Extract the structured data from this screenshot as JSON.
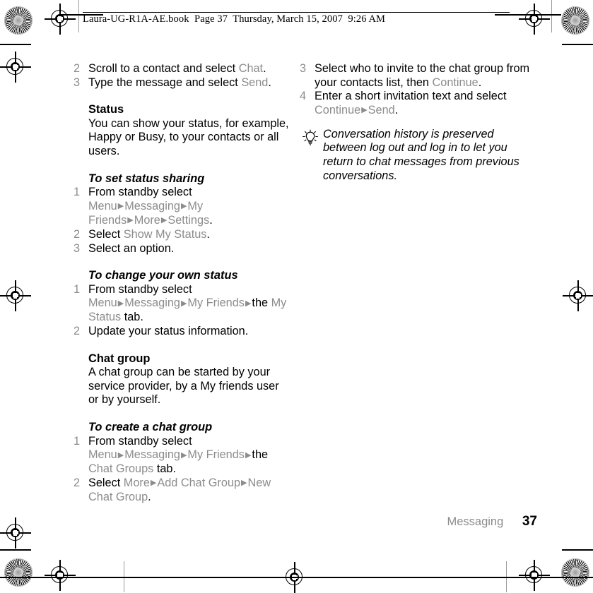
{
  "document": {
    "book_header": "Laura-UG-R1A-AE.book  Page 37  Thursday, March 15, 2007  9:26 AM",
    "footer_section": "Messaging",
    "page_number": "37",
    "colors": {
      "body_text": "#000000",
      "ui_term": "#8c8c8c",
      "background": "#ffffff"
    }
  },
  "left_column": {
    "steps_top": [
      {
        "num": "2",
        "parts": [
          {
            "t": "Scroll to a contact and select ",
            "s": "blk"
          },
          {
            "t": "Chat",
            "s": "ui"
          },
          {
            "t": ".",
            "s": "blk"
          }
        ]
      },
      {
        "num": "3",
        "parts": [
          {
            "t": "Type the message and select ",
            "s": "blk"
          },
          {
            "t": "Send",
            "s": "ui"
          },
          {
            "t": ".",
            "s": "blk"
          }
        ]
      }
    ],
    "status_heading": "Status",
    "status_body": "You can show your status, for example, Happy or Busy, to your contacts or all users.",
    "set_status_heading": "To set status sharing",
    "set_status_steps": [
      {
        "num": "1",
        "parts": [
          {
            "t": "From standby select ",
            "s": "blk"
          },
          {
            "t": "Menu",
            "s": "ui"
          },
          {
            "t": "▶",
            "s": "arrow"
          },
          {
            "t": "Messaging",
            "s": "ui"
          },
          {
            "t": "▶",
            "s": "arrow"
          },
          {
            "t": "My Friends",
            "s": "ui"
          },
          {
            "t": "▶",
            "s": "arrow"
          },
          {
            "t": "More",
            "s": "ui"
          },
          {
            "t": "▶",
            "s": "arrow"
          },
          {
            "t": "Settings",
            "s": "ui"
          },
          {
            "t": ".",
            "s": "blk"
          }
        ]
      },
      {
        "num": "2",
        "parts": [
          {
            "t": "Select ",
            "s": "blk"
          },
          {
            "t": "Show My Status",
            "s": "ui"
          },
          {
            "t": ".",
            "s": "blk"
          }
        ]
      },
      {
        "num": "3",
        "parts": [
          {
            "t": "Select an option.",
            "s": "blk"
          }
        ]
      }
    ],
    "change_status_heading": "To change your own status",
    "change_status_steps": [
      {
        "num": "1",
        "parts": [
          {
            "t": "From standby select ",
            "s": "blk"
          },
          {
            "t": "Menu",
            "s": "ui"
          },
          {
            "t": "▶",
            "s": "arrow"
          },
          {
            "t": "Messaging",
            "s": "ui"
          },
          {
            "t": "▶",
            "s": "arrow"
          },
          {
            "t": "My Friends",
            "s": "ui"
          },
          {
            "t": "▶",
            "s": "arrow"
          },
          {
            "t": "the ",
            "s": "blk"
          },
          {
            "t": "My Status",
            "s": "ui"
          },
          {
            "t": " tab.",
            "s": "blk"
          }
        ]
      },
      {
        "num": "2",
        "parts": [
          {
            "t": "Update your status information.",
            "s": "blk"
          }
        ]
      }
    ],
    "chat_group_heading": "Chat group",
    "chat_group_body": "A chat group can be started by your service provider, by a My friends user or by yourself.",
    "create_group_heading": "To create a chat group",
    "create_group_steps": [
      {
        "num": "1",
        "parts": [
          {
            "t": "From standby select ",
            "s": "blk"
          },
          {
            "t": "Menu",
            "s": "ui"
          },
          {
            "t": "▶",
            "s": "arrow"
          },
          {
            "t": "Messaging",
            "s": "ui"
          },
          {
            "t": "▶",
            "s": "arrow"
          },
          {
            "t": "My Friends",
            "s": "ui"
          },
          {
            "t": "▶",
            "s": "arrow"
          },
          {
            "t": "the ",
            "s": "blk"
          },
          {
            "t": "Chat Groups",
            "s": "ui"
          },
          {
            "t": " tab.",
            "s": "blk"
          }
        ]
      },
      {
        "num": "2",
        "parts": [
          {
            "t": "Select ",
            "s": "blk"
          },
          {
            "t": "More",
            "s": "ui"
          },
          {
            "t": "▶",
            "s": "arrow"
          },
          {
            "t": "Add Chat Group",
            "s": "ui"
          },
          {
            "t": "▶",
            "s": "arrow"
          },
          {
            "t": "New Chat Group",
            "s": "ui"
          },
          {
            "t": ".",
            "s": "blk"
          }
        ]
      }
    ]
  },
  "right_column": {
    "steps": [
      {
        "num": "3",
        "parts": [
          {
            "t": "Select who to invite to the chat group from your contacts list, then ",
            "s": "blk"
          },
          {
            "t": "Continue",
            "s": "ui"
          },
          {
            "t": ".",
            "s": "blk"
          }
        ]
      },
      {
        "num": "4",
        "parts": [
          {
            "t": "Enter a short invitation text and select ",
            "s": "blk"
          },
          {
            "t": "Continue",
            "s": "ui"
          },
          {
            "t": "▶",
            "s": "arrow"
          },
          {
            "t": "Send",
            "s": "ui"
          },
          {
            "t": ".",
            "s": "blk"
          }
        ]
      }
    ],
    "tip": {
      "icon": "lightbulb-tip-icon",
      "text": "Conversation history is preserved between log out and log in to let you return to chat messages from previous conversations."
    }
  },
  "printer_marks": {
    "registration_icon": "registration-crosshair-icon",
    "star_target_icon": "radial-star-target-icon",
    "count_registration": 7,
    "count_star_target": 4
  }
}
